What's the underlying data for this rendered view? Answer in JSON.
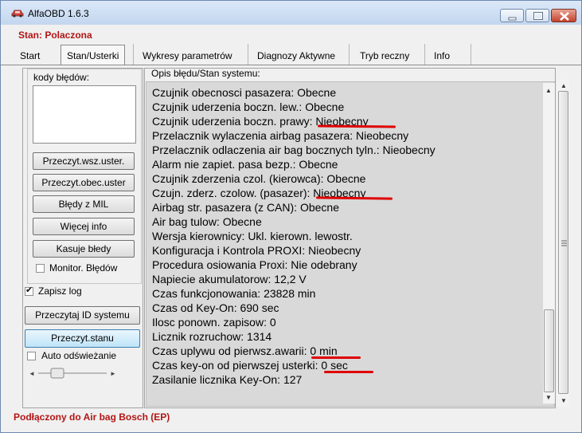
{
  "window": {
    "title": "AlfaOBD 1.6.3"
  },
  "status_line": "Stan: Polaczona",
  "tabs": [
    "Start",
    "Stan/Usterki",
    "Wykresy parametrów",
    "Diagnozy Aktywne",
    "Tryb reczny",
    "Info"
  ],
  "active_tab": "Stan/Usterki",
  "left_panel": {
    "codes_label": "kody błędów:",
    "buttons": {
      "read_all": "Przeczyt.wsz.uster.",
      "read_current": "Przeczyt.obec.uster",
      "mil_errors": "Błędy z MIL",
      "more_info": "Więcej info",
      "clear_errors": "Kasuje błedy"
    },
    "monitor_errors": {
      "label": "Monitor. Błędów",
      "checked": false
    },
    "save_log": {
      "label": "Zapisz log",
      "checked": true
    },
    "read_system_id": "Przeczytaj ID systemu",
    "read_state": "Przeczyt.stanu",
    "auto_refresh": {
      "label": "Auto odświeżanie",
      "checked": false
    }
  },
  "content": {
    "header": "Opis błędu/Stan systemu:",
    "lines": [
      "Czujnik obecnosci pasazera: Obecne",
      "Czujnik uderzenia boczn. lew.: Obecne",
      "Czujnik uderzenia boczn. prawy: Nieobecny",
      "Przelacznik wylaczenia airbag pasazera: Nieobecny",
      "Przelacznik odlaczenia air bag bocznych tyln.: Nieobecny",
      "Alarm nie zapiet. pasa bezp.: Obecne",
      "Czujnik zderzenia czol. (kierowca): Obecne",
      "Czujn. zderz. czolow. (pasazer): Nieobecny",
      "Airbag str. pasazera (z CAN): Obecne",
      "Air bag tulow: Obecne",
      "Wersja kierownicy: Ukl. kierown. lewostr.",
      "Konfiguracja i Kontrola PROXI: Nieobecny",
      "Procedura osiowania Proxi: Nie odebrany",
      "Napiecie akumulatorow: 12,2 V",
      "Czas funkcjonowania: 23828 min",
      "Czas od Key-On: 690 sec",
      "Ilosc ponown. zapisow: 0",
      "Licznik rozruchow: 1314",
      "Czas uplywu od pierwsz.awarii: 0 min",
      "Czas key-on od pierwszej usterki: 0 sec",
      "Zasilanie licznika Key-On: 127"
    ]
  },
  "bottom_status": "Podłączony do Air bag Bosch (EP)",
  "colors": {
    "status_red": "#b31515",
    "underline_red": "#e00000",
    "text_area_bg": "#d9d9d9"
  }
}
